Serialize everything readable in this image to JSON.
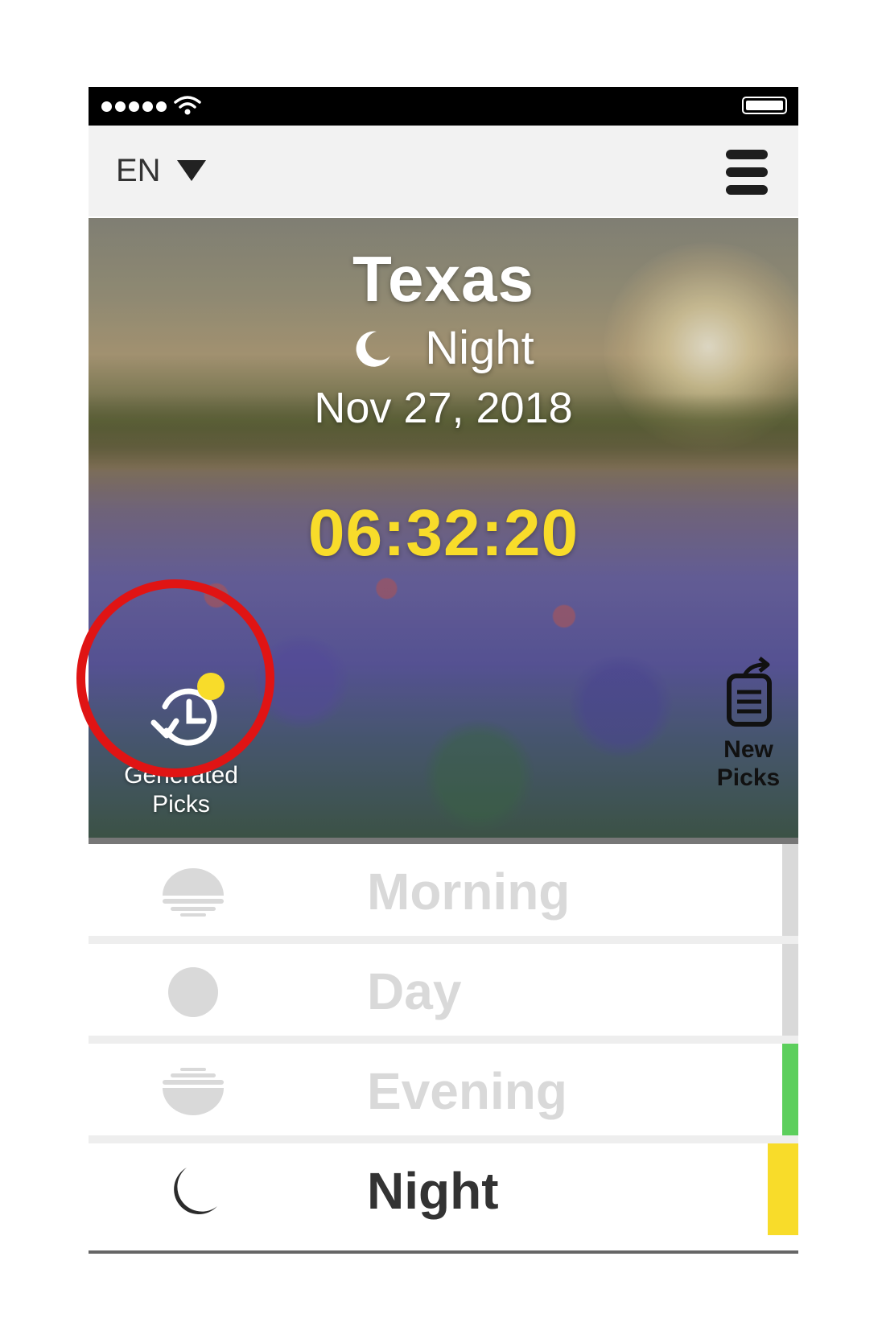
{
  "status_bar": {
    "signal_dots": 5,
    "wifi_icon": "wifi-icon",
    "battery_icon": "battery-icon"
  },
  "top_bar": {
    "language": "EN",
    "language_caret_icon": "caret-down-icon",
    "menu_icon": "hamburger-menu-icon"
  },
  "hero": {
    "location": "Texas",
    "period_icon": "moon-icon",
    "period": "Night",
    "date": "Nov 27, 2018",
    "countdown": "06:32:20",
    "generated_picks": {
      "label_line1": "Generated",
      "label_line2": "Picks",
      "icon": "history-clock-icon",
      "badge_color": "#f8dc2a",
      "highlight_color": "#e01414"
    },
    "new_picks": {
      "label_line1": "New",
      "label_line2": "Picks",
      "icon": "share-list-icon"
    }
  },
  "periods": [
    {
      "label": "Morning",
      "icon": "sunrise-icon",
      "indicator_color": "#d9d9d9",
      "active": false
    },
    {
      "label": "Day",
      "icon": "sun-circle-icon",
      "indicator_color": "#d9d9d9",
      "active": false
    },
    {
      "label": "Evening",
      "icon": "sunset-icon",
      "indicator_color": "#5ccf5c",
      "active": false
    },
    {
      "label": "Night",
      "icon": "moon-icon",
      "indicator_color": "#f8dc2a",
      "active": true
    }
  ]
}
